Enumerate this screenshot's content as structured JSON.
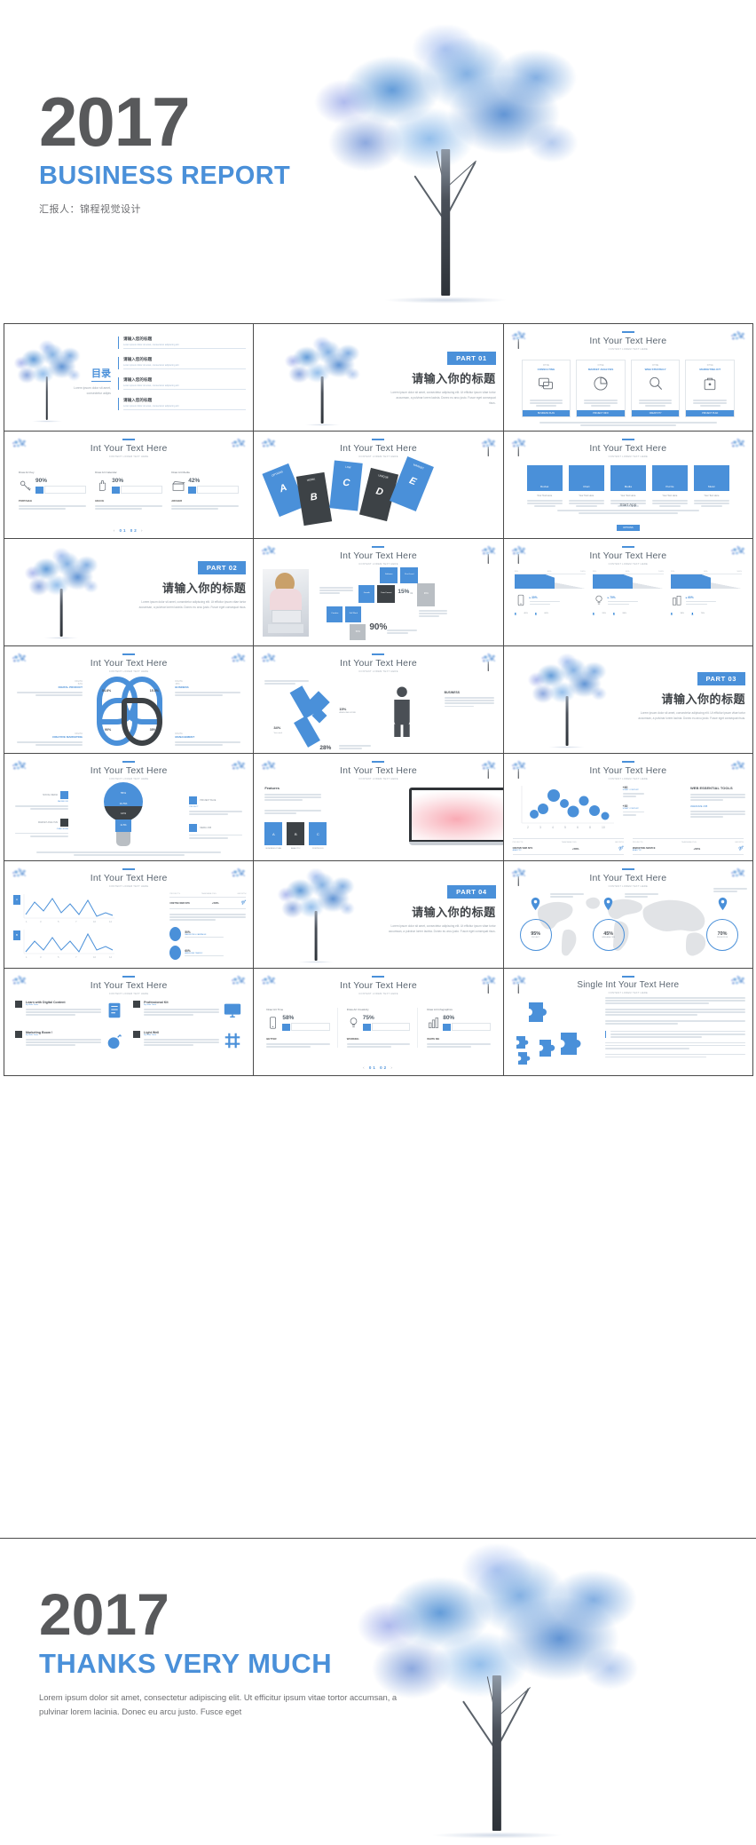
{
  "cover": {
    "year": "2017",
    "subtitle": "BUSINESS REPORT",
    "byline": "汇报人：锦程视觉设计",
    "tree_icon": "watercolor-tree"
  },
  "thanks": {
    "year": "2017",
    "subtitle": "THANKS VERY MUCH",
    "body": "Lorem ipsum dolor sit amet, consectetur adipiscing elit. Ut efficitur ipsum vitae tortor accumsan, a pulvinar lorem lacinia. Donec eu arcu justo. Fusce eget",
    "tree_icon": "watercolor-tree"
  },
  "common": {
    "section_title": "Int Your Text Here",
    "section_subtitle": "CONTENT LOREM TEXT HERE",
    "lorem_short": "Lorem ipsum dolor sit amet, consectetur adipiscing elit.",
    "title_zh": "请输入你的标题",
    "part_lorem": "Lorem ipsum dolor sit amet, consectetur adipiscing elit. Ut efficitur ipsum vitae tortor accumsan, a pulvinar lorem lacinia. Donec eu arcu justo. Fusce eget consequat risus.",
    "pager": "01 02"
  },
  "colors": {
    "accent": "#4a90d9",
    "dark_text": "#58595b",
    "body_text": "#6d6e71",
    "dark_box": "#3d4246",
    "grey_box": "#b9bec3",
    "border": "#4a4a4a"
  },
  "slides": [
    {
      "index": 1,
      "type": "toc",
      "contents_label": "目录",
      "contents_lorem": "Lorem ipsum dolor sit amet, consectetur adipis",
      "items": [
        {
          "title": "请输入您的标题",
          "desc": "Lorem ipsum dolor sit amet, consectetur adipiscing elit"
        },
        {
          "title": "请输入您的标题",
          "desc": "Lorem ipsum dolor sit amet, consectetur adipiscing elit"
        },
        {
          "title": "请输入您的标题",
          "desc": "Lorem ipsum dolor sit amet, consectetur adipiscing elit"
        },
        {
          "title": "请输入您的标题",
          "desc": "Lorem ipsum dolor sit amet, consectetur adipiscing elit"
        }
      ]
    },
    {
      "index": 2,
      "type": "part",
      "badge": "PART 01",
      "title_zh": "请输入你的标题",
      "lorem": "Lorem ipsum dolor sit amet, consectetur adipiscing elit. Ut efficitur ipsum vitae tortor accumsan, a pulvinar lorem lacinia. Donec eu arcu justo. Fusce eget consequat risus."
    },
    {
      "index": 3,
      "type": "four-cards",
      "title": "Int Your Text Here",
      "cards": [
        {
          "kicker": "FITNE",
          "name": "CONSULTING",
          "icon": "chat-bubbles-icon",
          "button": "BUSINESS PLAN"
        },
        {
          "kicker": "FITNE",
          "name": "MARKET ANALYSIS",
          "icon": "pie-clock-icon",
          "button": "PROJECT INFO"
        },
        {
          "kicker": "FITNE",
          "name": "WEB STRATEGY",
          "icon": "magnifier-icon",
          "button": "CREATIVITY"
        },
        {
          "kicker": "FITNE",
          "name": "MARKETING KIT",
          "icon": "briefcase-icon",
          "button": "PROJECT PLAN"
        }
      ]
    },
    {
      "index": 4,
      "type": "three-progress",
      "title": "Int Your Text Here",
      "items": [
        {
          "label": "Draw Art Key",
          "icon": "key-icon",
          "value": "90%",
          "caption": "PORTABLE"
        },
        {
          "label": "Draw Art Calendar",
          "icon": "hand-icon",
          "value": "30%",
          "caption": "GRACE"
        },
        {
          "label": "Draw Art Media",
          "icon": "clapper-icon",
          "value": "42%",
          "caption": "ARCHER"
        }
      ],
      "pager": "01 02"
    },
    {
      "index": 5,
      "type": "tilted-cards",
      "title": "Int Your Text Here",
      "cards": [
        {
          "letter": "A",
          "label": "OPTIONS"
        },
        {
          "letter": "B",
          "label": "WORK"
        },
        {
          "letter": "C",
          "label": "LAW"
        },
        {
          "letter": "D",
          "label": "UNIQUE"
        },
        {
          "letter": "E",
          "label": "MARKET"
        }
      ]
    },
    {
      "index": 6,
      "type": "five-tiles",
      "title": "Int Your Text Here",
      "tiles": [
        {
          "label": "Rocket",
          "caption": "Your Text Here"
        },
        {
          "label": "Chart",
          "caption": "Your Text Here"
        },
        {
          "label": "Media",
          "caption": "Your Text Here"
        },
        {
          "label": "Puzzle",
          "caption": "Your Text Here"
        },
        {
          "label": "Music",
          "caption": "Your Text Here"
        }
      ],
      "footer_title": "Start App",
      "footer_button": "OPTIONS"
    },
    {
      "index": 7,
      "type": "part",
      "badge": "PART 02",
      "title_zh": "请输入你的标题",
      "lorem": "Lorem ipsum dolor sit amet, consectetur adipiscing elit. Ut efficitur ipsum vitae tortor accumsan, a pulvinar lorem lacinia. Donec eu arcu justo. Fusce eget consequat risus."
    },
    {
      "index": 8,
      "type": "photo-blocks",
      "title": "Int Your Text Here",
      "photo": "woman-at-desk-photo",
      "values": [
        "15%",
        "96%",
        "90%",
        "50%"
      ],
      "step": "01",
      "blocks": [
        "Creative",
        "Software",
        "First Level",
        "Data Format",
        "Growth",
        "Full Work"
      ]
    },
    {
      "index": 9,
      "type": "three-triangles",
      "title": "Int Your Text Here",
      "items": [
        {
          "icon": "phone-icon",
          "value": "30%",
          "a": "40%",
          "b": "60%"
        },
        {
          "icon": "bulb-icon",
          "value": "70%",
          "a": "20%",
          "b": "80%"
        },
        {
          "icon": "building-icon",
          "value": "60%",
          "a": "30%",
          "b": "70%"
        }
      ]
    },
    {
      "index": 10,
      "type": "flower-chart",
      "title": "Int Your Text Here",
      "petals": [
        {
          "value": "54.8%",
          "caption": "MARKETING"
        },
        {
          "value": "15.5%",
          "caption": "CREATIVE"
        },
        {
          "value": "90%",
          "caption": "PROFESSIONAL"
        },
        {
          "value": "35%",
          "caption": "PROMOTION"
        }
      ],
      "legends": [
        "DIGITAL PRODUCT",
        "BUSINESS",
        "CREATIVE MARKETING",
        "MANAGEMENT"
      ]
    },
    {
      "index": 11,
      "type": "diamond-person",
      "title": "Int Your Text Here",
      "values": [
        "34%",
        "15%",
        "28%"
      ],
      "labels": [
        "Your work",
        "AWESOME WORK",
        "PROJECT"
      ],
      "person_label": "BUSINESS"
    },
    {
      "index": 12,
      "type": "part",
      "badge": "PART 03",
      "title_zh": "请输入你的标题",
      "lorem": "Lorem ipsum dolor sit amet, consectetur adipiscing elit. Ut efficitur ipsum vitae tortor accumsan, a pulvinar lorem lacinia. Donec eu arcu justo. Fusce eget consequat risus."
    },
    {
      "index": 13,
      "type": "bulb-funnel",
      "title": "Int Your Text Here",
      "segments": [
        "55%",
        "31.5%",
        "14%",
        "11.5%"
      ],
      "tags": [
        "SOCIAL MEDIA",
        "MARKET ANALYSIS",
        "FACEBOOK",
        "CHALLENGE",
        "PROJECT BLUE",
        "PROJECT",
        "MEDIA JOB"
      ]
    },
    {
      "index": 14,
      "type": "laptop",
      "title": "Int Your Text Here",
      "feature_label": "Features",
      "cards": [
        {
          "letter": "A",
          "caption": "BUSINESS PLAN"
        },
        {
          "letter": "B",
          "caption": "ANALYTIC"
        },
        {
          "letter": "C",
          "caption": "PORTFOLIO"
        }
      ]
    },
    {
      "index": 15,
      "type": "bubble-chart",
      "title": "Int Your Text Here",
      "right_heading": "WEB ESSENTIAL TOOLS",
      "right_sub": "AWESOME JOB",
      "kpis": [
        {
          "label": "+60",
          "sub": "START CONTENT"
        },
        {
          "label": "+30",
          "sub": "START CONTENT"
        }
      ],
      "table": {
        "headers": [
          "PROJECTS",
          "TEAM ANALYSIS",
          "GROWTH"
        ],
        "rows": [
          {
            "name": "CRETIVE WEB SITE",
            "tag": "ANALYTIC",
            "value": "+58%",
            "growth": "Marketing Value"
          },
          {
            "name": "MARKETING SERVICE",
            "tag": "ANALYTIC",
            "value": "+60%",
            "growth": "Marketing Value"
          }
        ]
      }
    },
    {
      "index": 16,
      "type": "line-charts",
      "title": "Int Your Text Here",
      "series_labels": [
        "A",
        "B"
      ],
      "x_ticks": [
        "1",
        "2",
        "3",
        "4",
        "5",
        "6",
        "7",
        "8",
        "9",
        "10",
        "12"
      ],
      "table_headers": [
        "PROJECTS",
        "TEAM ANALYSIS",
        "GROWTH"
      ],
      "table_row": {
        "name": "CRETIVE WEB SITE",
        "value": "+58%"
      },
      "pills": [
        {
          "value": "50%",
          "caption": "MARKETING CAMPAIGN"
        },
        {
          "value": "60%",
          "caption": "AWESOME TRAFFIC"
        }
      ]
    },
    {
      "index": 17,
      "type": "part",
      "badge": "PART 04",
      "title_zh": "请输入你的标题",
      "lorem": "Lorem ipsum dolor sit amet, consectetur adipiscing elit. Ut efficitur ipsum vitae tortor accumsan, a pulvinar lorem lacinia. Donec eu arcu justo. Fusce eget consequat risus."
    },
    {
      "index": 18,
      "type": "world-map",
      "title": "Int Your Text Here",
      "markers": [
        {
          "value": "95%",
          "caption": "PROJECT"
        },
        {
          "value": "45%",
          "caption": "WEB ANALYSIS"
        },
        {
          "value": "70%",
          "caption": "PROMOTION"
        }
      ]
    },
    {
      "index": 19,
      "type": "feature-list",
      "title": "Int Your Text Here",
      "features": [
        {
          "name": "Learn with Digital Content",
          "by": "By Slide Team",
          "icon": "notebook-icon"
        },
        {
          "name": "Professional Kit",
          "by": "By Slide Team",
          "icon": "monitor-icon"
        },
        {
          "name": "Marketing Boom !",
          "by": "By Slide Team",
          "icon": "bomb-icon"
        },
        {
          "name": "Light Well",
          "by": "By Slide Team",
          "icon": "hash-icon"
        }
      ]
    },
    {
      "index": 20,
      "type": "three-bars",
      "title": "Int Your Text Here",
      "items": [
        {
          "label": "Draw Art Time",
          "icon": "phone-icon",
          "value": "58%",
          "caption": "BETTER"
        },
        {
          "label": "Draw Art Creativity",
          "icon": "bulb-icon",
          "value": "75%",
          "caption": "WORKING"
        },
        {
          "label": "Draw Art Infographics",
          "icon": "bars-icon",
          "value": "80%",
          "caption": "WHITE ME"
        }
      ],
      "pager": "01 02"
    },
    {
      "index": 21,
      "type": "puzzle",
      "title": "Single Int Your Text Here",
      "paragraphs": [
        "Consectetur dolore congue lacus pretium id, integer aenean accumsan lacus wisi, massa porttitor molestie mauris sed lacus dis enim litora ut. Consectetur eu conubia lorem ipsum.",
        "Curabitur auctor, mattis condimentum non nibh faucibus pulvinar, ipsum sed nec fusce viverra id, lorem tellus lorem ipsum dolor sit.",
        "Curabitur auctor, mattis condimentum non nibh faucibus, ipsum sed nec fusce viverra id lorem ipsum dolor."
      ],
      "quote": "Consectetur dolore congue lacus pretium id, integer aenean accumsan lacus wisi massa porttitor molestie mauris sed lacus dis enim litora."
    }
  ]
}
